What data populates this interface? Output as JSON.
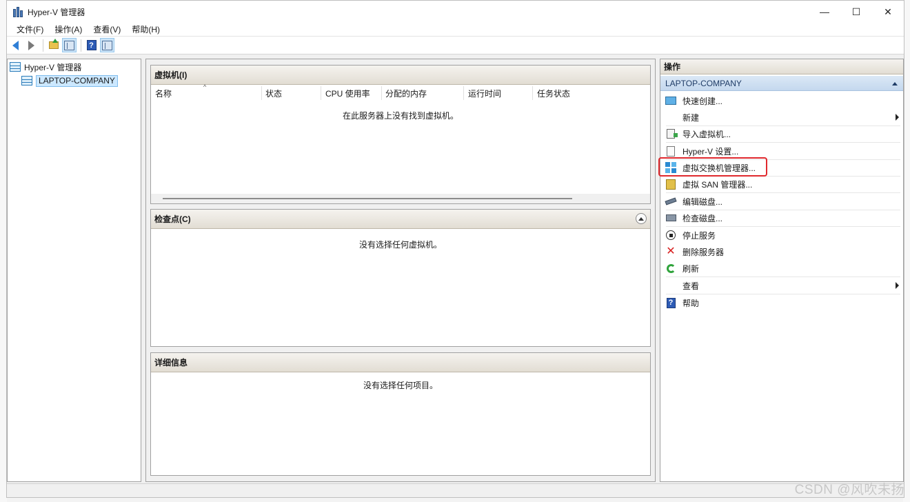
{
  "window": {
    "title": "Hyper-V 管理器",
    "controls": {
      "minimize": "—",
      "maximize": "☐",
      "close": "✕"
    }
  },
  "menu": [
    "文件(F)",
    "操作(A)",
    "查看(V)",
    "帮助(H)"
  ],
  "toolbar": {
    "icons": [
      "back-arrow-icon",
      "forward-arrow-icon",
      "up-folder-icon",
      "show-hide-console-tree-icon",
      "help-icon",
      "show-hide-action-pane-icon"
    ]
  },
  "tree": {
    "root": "Hyper-V 管理器",
    "server": "LAPTOP-COMPANY"
  },
  "vm_panel": {
    "title": "虚拟机(I)",
    "columns": [
      "名称",
      "状态",
      "CPU 使用率",
      "分配的内存",
      "运行时间",
      "任务状态"
    ],
    "sort_indicator": "^",
    "empty_message": "在此服务器上没有找到虚拟机。"
  },
  "checkpoint_panel": {
    "title": "检查点(C)",
    "empty_message": "没有选择任何虚拟机。"
  },
  "details_panel": {
    "title": "详细信息",
    "empty_message": "没有选择任何项目。"
  },
  "actions": {
    "title": "操作",
    "group": "LAPTOP-COMPANY",
    "items": [
      {
        "label": "快速创建...",
        "icon": "quick-create-icon"
      },
      {
        "label": "新建",
        "icon": "",
        "submenu": true
      },
      {
        "label": "导入虚拟机...",
        "icon": "import-vm-icon"
      },
      {
        "label": "Hyper-V 设置...",
        "icon": "settings-doc-icon"
      },
      {
        "label": "虚拟交换机管理器...",
        "icon": "virtual-switch-icon",
        "highlighted": true
      },
      {
        "label": "虚拟 SAN 管理器...",
        "icon": "san-icon"
      },
      {
        "label": "编辑磁盘...",
        "icon": "edit-disk-icon"
      },
      {
        "label": "检查磁盘...",
        "icon": "inspect-disk-icon"
      },
      {
        "label": "停止服务",
        "icon": "stop-service-icon"
      },
      {
        "label": "删除服务器",
        "icon": "remove-server-icon"
      },
      {
        "label": "刷新",
        "icon": "refresh-icon"
      },
      {
        "label": "查看",
        "icon": "",
        "submenu": true
      },
      {
        "label": "帮助",
        "icon": "help-icon"
      }
    ]
  },
  "highlight_color": "#e0282d",
  "watermark": "CSDN @风吹未扬"
}
